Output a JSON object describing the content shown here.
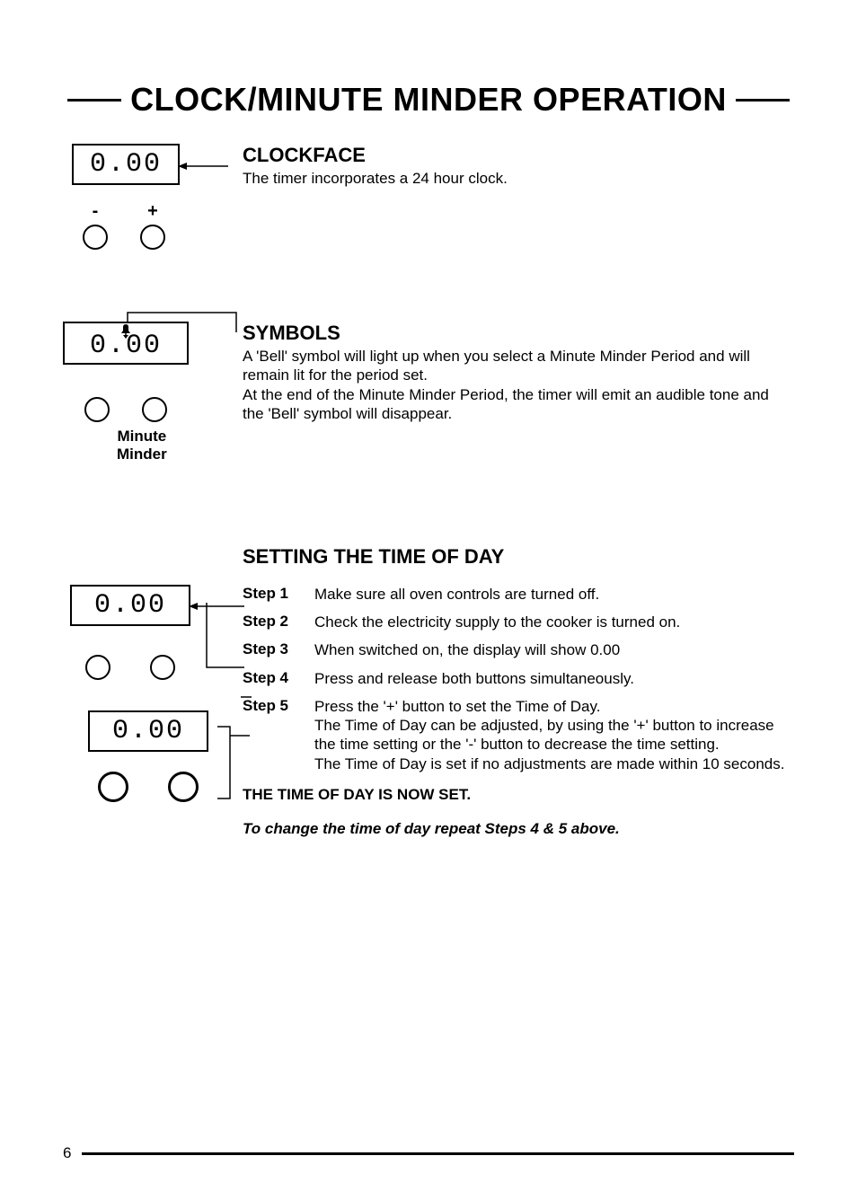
{
  "title": "CLOCK/MINUTE MINDER OPERATION",
  "clockface": {
    "heading": "CLOCKFACE",
    "text": "The timer incorporates a 24 hour clock.",
    "display": "0.00",
    "minus": "-",
    "plus": "+"
  },
  "symbols": {
    "heading": "SYMBOLS",
    "line1": "A 'Bell' symbol will light up when you select a Minute Minder Period and will remain lit for the period set.",
    "line2": "At the end of the Minute Minder Period, the timer will emit an audible tone and the 'Bell' symbol will disappear.",
    "display": "0.00",
    "mm_label1": "Minute",
    "mm_label2": "Minder"
  },
  "setting": {
    "heading": "SETTING THE TIME OF DAY",
    "display1": "0.00",
    "display2": "0.00",
    "steps": [
      {
        "label": "Step 1",
        "text": "Make sure all oven controls are turned off."
      },
      {
        "label": "Step 2",
        "text": "Check the electricity supply to the cooker is turned on."
      },
      {
        "label": "Step 3",
        "text": "When switched on, the display will show 0.00"
      },
      {
        "label": "Step 4",
        "text": "Press and release both buttons simultaneously."
      },
      {
        "label": "Step 5",
        "text": "Press the '+' button to set the Time of Day.\nThe Time of Day can be adjusted, by using the '+' button to increase the time setting or the '-' button to decrease the time setting.\nThe Time of Day is set if no adjustments are made within 10 seconds."
      }
    ],
    "now_set": "THE TIME OF DAY IS NOW SET.",
    "repeat": "To change the time of day repeat Steps 4  & 5 above."
  },
  "page_number": "6"
}
